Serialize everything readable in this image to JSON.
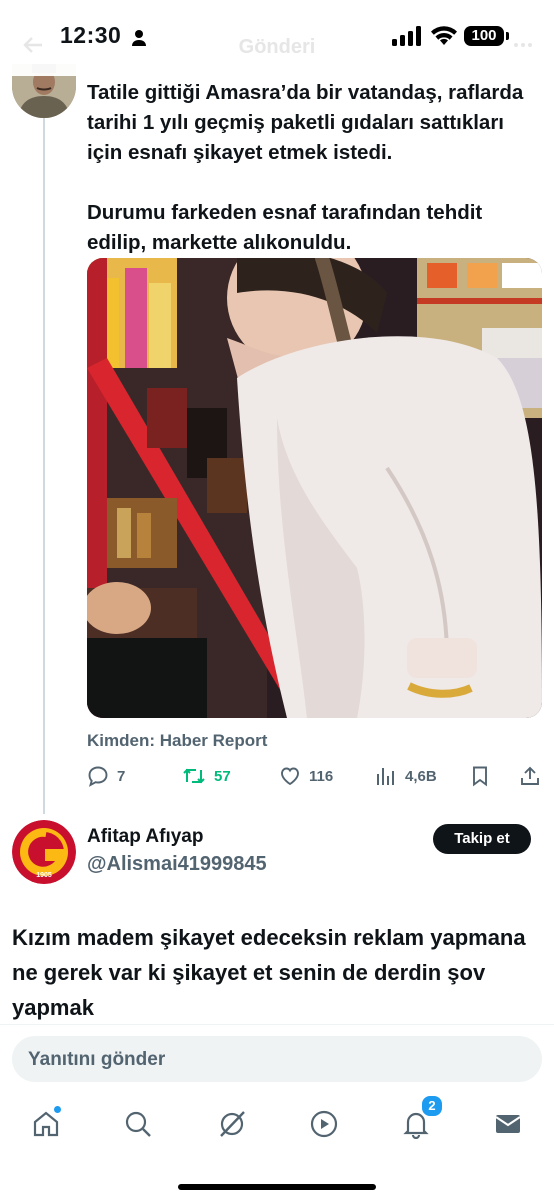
{
  "status_bar": {
    "time": "12:30",
    "battery": "100"
  },
  "header": {
    "title": "Gönderi"
  },
  "tweet": {
    "text": "Tatile gittiği Amasra’da bir vatandaş, raflarda tarihi 1 yılı geçmiş paketli gıdaları sattıkları için esnafı şikayet etmek istedi.\n\nDurumu farkeden esnaf tarafından tehdit edilip, markette alıkonuldu.",
    "source": "Kimden: Haber Report",
    "stats": {
      "replies": "7",
      "retweets": "57",
      "likes": "116",
      "views": "4,6B"
    }
  },
  "reply": {
    "name": "Afitap Afıyap",
    "handle": "@Alismai41999845",
    "follow_label": "Takip et",
    "avatar_text": "1905",
    "text": "Kızım madem şikayet edeceksin reklam yapmana ne gerek var ki şikayet et senin de derdin şov yapmak"
  },
  "composer": {
    "placeholder": "Yanıtını gönder"
  },
  "tab_bar": {
    "items": [
      {
        "icon": "home-icon"
      },
      {
        "icon": "search-icon"
      },
      {
        "icon": "grok-icon"
      },
      {
        "icon": "video-icon"
      },
      {
        "icon": "notifications-icon",
        "badge": "2"
      },
      {
        "icon": "messages-icon"
      }
    ]
  },
  "colors": {
    "accent": "#1d9bf0",
    "retweet": "#00ba7c",
    "secondary_text": "#536471",
    "galatasaray_red": "#c8102e",
    "galatasaray_yellow": "#fdb913"
  }
}
